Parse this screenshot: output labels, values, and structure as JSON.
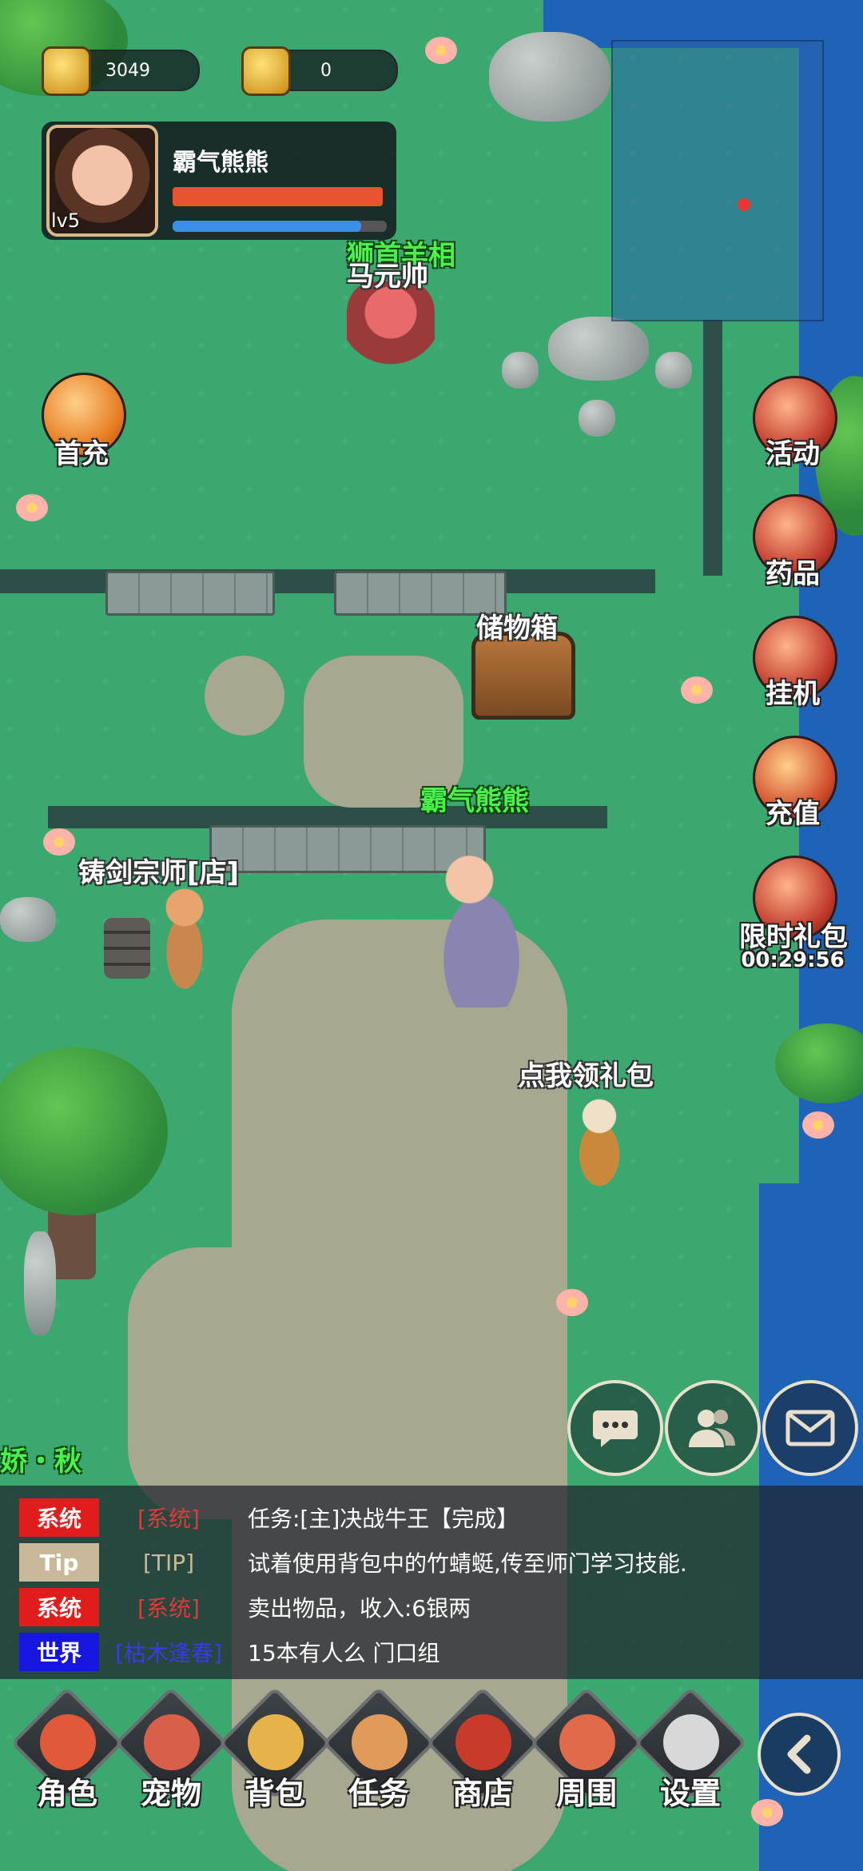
{
  "hud": {
    "coins": "3049",
    "gold": "0",
    "player": {
      "name": "霸气熊熊",
      "level": "lv5",
      "hp_fraction": 0.98,
      "mp_fraction": 0.88
    }
  },
  "npcs": {
    "ma_yuan_shi": "马元帅",
    "ma_yuan_shi_subtitle": "狮首羊相",
    "storage_box": "储物箱",
    "player_label": "霸气熊熊",
    "sword_master": "铸剑宗师[店]",
    "gift_npc": "点我领礼包",
    "left_edge_label": "娇・秋"
  },
  "left_buttons": {
    "first_recharge": "首充"
  },
  "right_buttons": [
    {
      "label": "活动",
      "icon": "event-icon"
    },
    {
      "label": "药品",
      "icon": "potion-icon"
    },
    {
      "label": "挂机",
      "icon": "auto-battle-icon"
    },
    {
      "label": "充值",
      "icon": "treasure-chest-icon"
    },
    {
      "label": "限时礼包",
      "icon": "gift-bag-icon"
    }
  ],
  "limited_gift_timer": "00:29:56",
  "action_buttons": [
    {
      "icon": "chat-bubble-icon"
    },
    {
      "icon": "friends-icon"
    },
    {
      "icon": "mail-icon"
    }
  ],
  "chat": [
    {
      "tag": "系统",
      "tag_color": "#e01c1c",
      "source": "[系统]",
      "source_color": "#e03a3a",
      "message": "任务:[主]决战牛王【完成】"
    },
    {
      "tag": "Tip",
      "tag_color": "#c9b99a",
      "source": "[TIP]",
      "source_color": "#c9b99a",
      "message": "试着使用背包中的竹蜻蜓,传至师门学习技能."
    },
    {
      "tag": "系统",
      "tag_color": "#e01c1c",
      "source": "[系统]",
      "source_color": "#e03a3a",
      "message": "卖出物品，收入:6银两"
    },
    {
      "tag": "世界",
      "tag_color": "#1616e0",
      "source": "[枯木逢春]",
      "source_color": "#3a3ae8",
      "message": "15本有人么 门口组"
    }
  ],
  "nav": [
    {
      "label": "角色",
      "icon": "character-icon",
      "color": "#e05a3a"
    },
    {
      "label": "宠物",
      "icon": "pet-icon",
      "color": "#d8604a"
    },
    {
      "label": "背包",
      "icon": "backpack-icon",
      "color": "#e8b24a"
    },
    {
      "label": "任务",
      "icon": "quest-scroll-icon",
      "color": "#e09a5a"
    },
    {
      "label": "商店",
      "icon": "shop-icon",
      "color": "#c83a2a"
    },
    {
      "label": "周围",
      "icon": "compass-icon",
      "color": "#e06a4a"
    },
    {
      "label": "设置",
      "icon": "gear-icon",
      "color": "#d8d8d8"
    }
  ]
}
